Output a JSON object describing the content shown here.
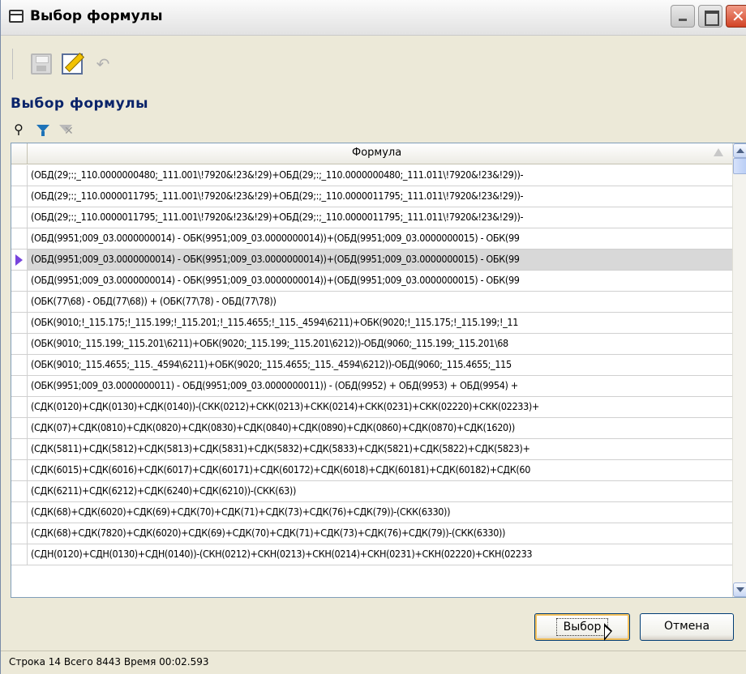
{
  "window": {
    "title": "Выбор формулы"
  },
  "toolbar": {
    "save": "save-icon",
    "edit": "edit-icon",
    "undo": "undo-icon"
  },
  "section": {
    "title": "Выбор формулы"
  },
  "grid": {
    "header": "Формула",
    "selected_index": 4,
    "rows": [
      "(ОБД(29;:;_110.0000000480;_111.001\\!7920&!23&!29)+ОБД(29;:;_110.0000000480;_111.011\\!7920&!23&!29))-",
      "(ОБД(29;:;_110.0000011795;_111.001\\!7920&!23&!29)+ОБД(29;:;_110.0000011795;_111.011\\!7920&!23&!29))-",
      "(ОБД(29;:;_110.0000011795;_111.001\\!7920&!23&!29)+ОБД(29;:;_110.0000011795;_111.011\\!7920&!23&!29))-",
      "(ОБД(9951;009_03.0000000014) - ОБК(9951;009_03.0000000014))+(ОБД(9951;009_03.0000000015) - ОБК(99",
      "(ОБД(9951;009_03.0000000014) - ОБК(9951;009_03.0000000014))+(ОБД(9951;009_03.0000000015) - ОБК(99",
      "(ОБД(9951;009_03.0000000014) - ОБК(9951;009_03.0000000014))+(ОБД(9951;009_03.0000000015) - ОБК(99",
      "(ОБК(77\\68) - ОБД(77\\68)) + (ОБК(77\\78) - ОБД(77\\78))",
      "(ОБК(9010;!_115.175;!_115.199;!_115.201;!_115.4655;!_115._4594\\6211)+ОБК(9020;!_115.175;!_115.199;!_11",
      "(ОБК(9010;_115.199;_115.201\\6211)+ОБК(9020;_115.199;_115.201\\6212))-ОБД(9060;_115.199;_115.201\\68",
      "(ОБК(9010;_115.4655;_115._4594\\6211)+ОБК(9020;_115.4655;_115._4594\\6212))-ОБД(9060;_115.4655;_115",
      "(ОБК(9951;009_03.0000000011) - ОБД(9951;009_03.0000000011)) - (ОБД(9952) + ОБД(9953) + ОБД(9954) +",
      "(СДК(0120)+СДК(0130)+СДК(0140))-(СКК(0212)+СКК(0213)+СКК(0214)+СКК(0231)+СКК(02220)+СКК(02233)+",
      "(СДК(07)+СДК(0810)+СДК(0820)+СДК(0830)+СДК(0840)+СДК(0890)+СДК(0860)+СДК(0870)+СДК(1620))",
      "(СДК(5811)+СДК(5812)+СДК(5813)+СДК(5831)+СДК(5832)+СДК(5833)+СДК(5821)+СДК(5822)+СДК(5823)+",
      "(СДК(6015)+СДК(6016)+СДК(6017)+СДК(60171)+СДК(60172)+СДК(6018)+СДК(60181)+СДК(60182)+СДК(60",
      "(СДК(6211)+СДК(6212)+СДК(6240)+СДК(6210))-(СКК(63))",
      "(СДК(68)+СДК(6020)+СДК(69)+СДК(70)+СДК(71)+СДК(73)+СДК(76)+СДК(79))-(СКК(6330))",
      "(СДК(68)+СДК(7820)+СДК(6020)+СДК(69)+СДК(70)+СДК(71)+СДК(73)+СДК(76)+СДК(79))-(СКК(6330))",
      "(СДН(0120)+СДН(0130)+СДН(0140))-(СКН(0212)+СКН(0213)+СКН(0214)+СКН(0231)+СКН(02220)+СКН(02233"
    ]
  },
  "buttons": {
    "select": "Выбор",
    "cancel": "Отмена"
  },
  "status": {
    "text": "Строка 14 Всего 8443 Время 00:02.593"
  }
}
